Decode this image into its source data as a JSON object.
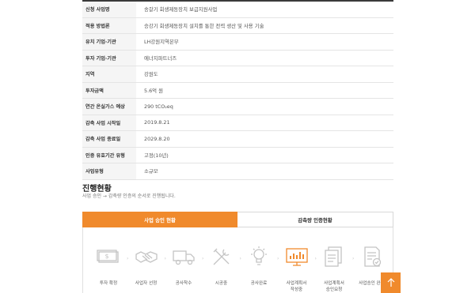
{
  "info_rows": [
    {
      "label": "신청 사업명",
      "value": "송갈기 회생제동장치 보급지원사업"
    },
    {
      "label": "적용 방법론",
      "value": "승강기 회생제동장치 설치를 통한 전력 생산 및 사용 기술"
    },
    {
      "label": "유치 기업·기관",
      "value": "LH강원지역본부"
    },
    {
      "label": "투자 기업·기관",
      "value": "에너지파트너즈"
    },
    {
      "label": "지역",
      "value": "강원도"
    },
    {
      "label": "투자금액",
      "value": "5.6억 원"
    },
    {
      "label": "연간 온실가스 예상",
      "value": "290 tCO₂eq"
    },
    {
      "label": "감축 사업 시작일",
      "value": "2019.8.21"
    },
    {
      "label": "감축 사업 종료일",
      "value": "2029.8.20"
    },
    {
      "label": "인증 유효기간 유형",
      "value": "고정(10년)"
    },
    {
      "label": "사업유형",
      "value": "소규모"
    }
  ],
  "progress": {
    "title": "진행현황",
    "subtitle": "사업 승인 → 감축량 인증의 순서로 진행됩니다.",
    "tabs": [
      {
        "label": "사업 승인 현황",
        "active": true
      },
      {
        "label": "감축량 인증현황",
        "active": false
      }
    ],
    "steps": [
      {
        "icon": "money-icon",
        "label": "투자 확정",
        "highlight": false
      },
      {
        "icon": "handshake-icon",
        "label": "사업자 선정",
        "highlight": false
      },
      {
        "icon": "truck-icon",
        "label": "공사착수",
        "highlight": false
      },
      {
        "icon": "tools-icon",
        "label": "시공중",
        "highlight": false
      },
      {
        "icon": "lightbulb-icon",
        "label": "공사완료",
        "highlight": false
      },
      {
        "icon": "monitor-chart-icon",
        "label": "사업계획서\n작성중",
        "highlight": true
      },
      {
        "icon": "documents-icon",
        "label": "사업계획서\n승인요청",
        "highlight": false
      },
      {
        "icon": "document-check-icon",
        "label": "사업승인 완료",
        "highlight": false
      }
    ]
  },
  "colors": {
    "accent": "#f08a2c",
    "icon_gray": "#c4c4c4"
  }
}
